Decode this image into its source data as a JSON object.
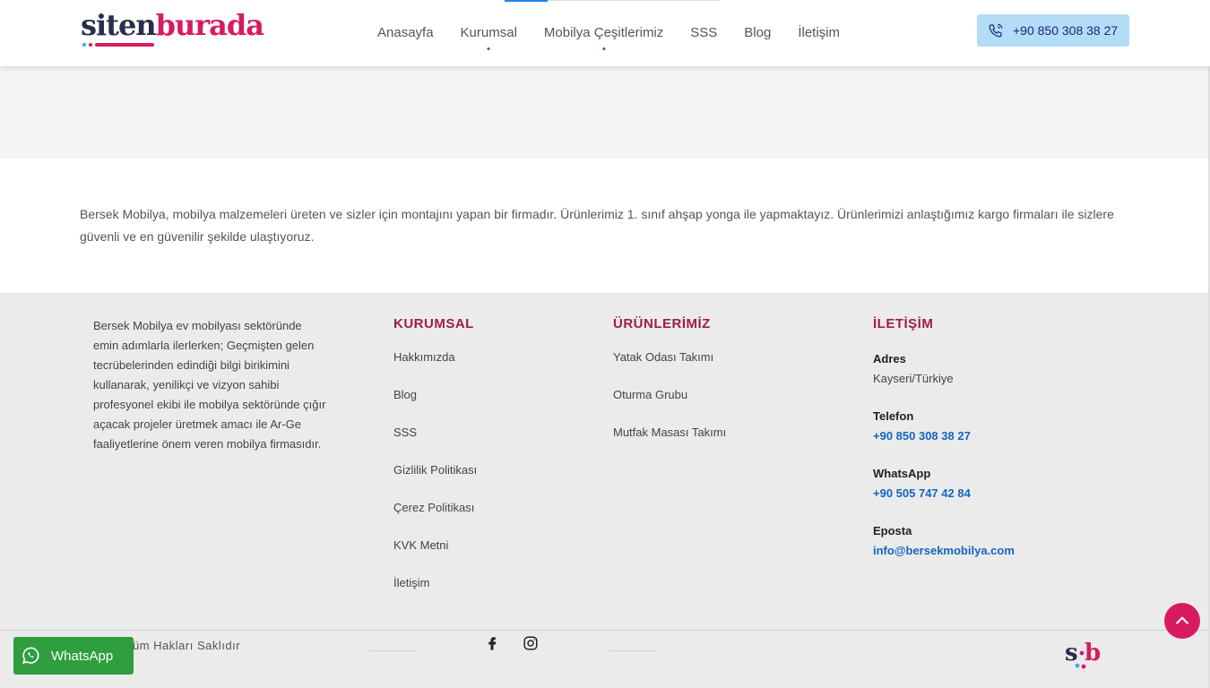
{
  "header": {
    "logo": {
      "part1": "siten",
      "part2": "burada"
    },
    "nav": [
      {
        "label": "Anasayfa",
        "has_dot": false
      },
      {
        "label": "Kurumsal",
        "has_dot": true
      },
      {
        "label": "Mobilya Çeşitlerimiz",
        "has_dot": true
      },
      {
        "label": "SSS",
        "has_dot": false
      },
      {
        "label": "Blog",
        "has_dot": false
      },
      {
        "label": "İletişim",
        "has_dot": false
      }
    ],
    "phone": "+90 850 308 38 27"
  },
  "about": {
    "text": "Bersek Mobilya, mobilya malzemeleri üreten ve sizler için montajını yapan bir firmadır. Ürünlerimiz 1. sınıf ahşap yonga ile yapmaktayız. Ürünlerimizi anlaştığımız kargo firmaları ile sizlere güvenli ve en güvenilir şekilde ulaştıyoruz."
  },
  "footer": {
    "description": "Bersek Mobilya ev mobilyası sektöründe emin adımlarla ilerlerken; Geçmişten gelen tecrübelerinden edindiği bilgi birikimini kullanarak, yenilikçi ve vizyon sahibi profesyonel ekibi ile mobilya sektöründe çığır açacak projeler üretmek amacı ile Ar-Ge faaliyetlerine önem veren mobilya firmasıdır.",
    "kurumsal": {
      "heading": "KURUMSAL",
      "links": [
        "Hakkımızda",
        "Blog",
        "SSS",
        "Gizlilik Politikası",
        "Çerez Politikası",
        "KVK Metni",
        "İletişim"
      ]
    },
    "urunler": {
      "heading": "ÜRÜNLERİMİZ",
      "links": [
        "Yatak Odası Takımı",
        "Oturma Grubu",
        "Mutfak Masası Takımı"
      ]
    },
    "iletisim": {
      "heading": "İLETİŞİM",
      "address_label": "Adres",
      "address": "Kayseri/Türkiye",
      "phone_label": "Telefon",
      "phone": "+90 850 308 38 27",
      "whatsapp_label": "WhatsApp",
      "whatsapp": "+90 505 747 42 84",
      "email_label": "Eposta",
      "email": "info@bersekmobilya.com"
    },
    "copyright": "üm Hakları Saklıdır",
    "social": [
      "facebook-icon",
      "instagram-icon"
    ]
  },
  "whatsapp_button": {
    "label": "WhatsApp"
  },
  "colors": {
    "brand_pink": "#d81b60",
    "brand_navy": "#2b2e4a",
    "link_blue": "#1565c0",
    "whatsapp_green": "#2e9e3e"
  }
}
